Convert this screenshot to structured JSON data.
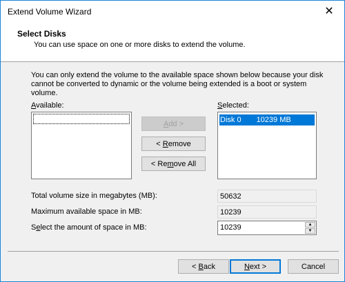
{
  "window": {
    "title": "Extend Volume Wizard",
    "close_glyph": "✕"
  },
  "header": {
    "title": "Select Disks",
    "subtitle": "You can use space on one or more disks to extend the volume."
  },
  "info_text": "You can only extend the volume to the available space shown below because your disk cannot be converted to dynamic or the volume being extended is a boot or system volume.",
  "available": {
    "label_accel": "A",
    "label_rest": "vailable:",
    "items": []
  },
  "selected": {
    "label_accel": "S",
    "label_rest": "elected:",
    "items": [
      {
        "disk": "Disk 0",
        "size": "10239 MB"
      }
    ]
  },
  "buttons": {
    "add": {
      "accel": "A",
      "rest": "dd >"
    },
    "remove": {
      "prefix": "< ",
      "accel": "R",
      "rest": "emove"
    },
    "remove_all": {
      "prefix": "< Re",
      "accel": "m",
      "rest": "ove All"
    },
    "back": {
      "prefix": "< ",
      "accel": "B",
      "rest": "ack"
    },
    "next": {
      "accel": "N",
      "rest": "ext >"
    },
    "cancel": "Cancel"
  },
  "fields": {
    "total_label": "Total volume size in megabytes (MB):",
    "total_value": "50632",
    "max_label": "Maximum available space in MB:",
    "max_value": "10239",
    "amount_label_prefix": "S",
    "amount_label_accel": "e",
    "amount_label_rest": "lect the amount of space in MB:",
    "amount_value": "10239"
  },
  "colors": {
    "accent": "#0078d7",
    "border": "#1883d7"
  }
}
